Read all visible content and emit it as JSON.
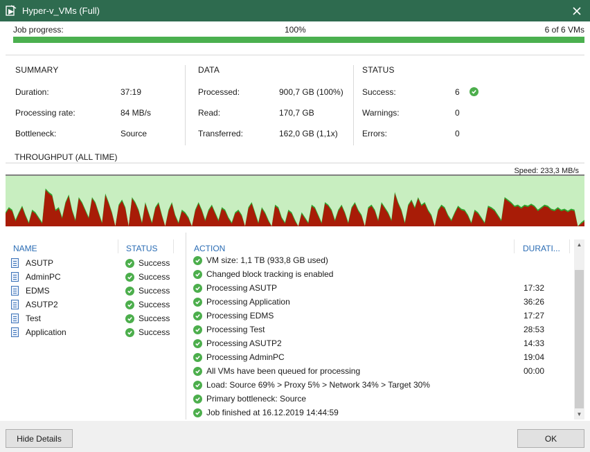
{
  "window": {
    "title": "Hyper-v_VMs (Full)"
  },
  "progress": {
    "label": "Job progress:",
    "percent_text": "100%",
    "vms_text": "6 of 6 VMs",
    "fraction": 1.0
  },
  "summary": {
    "heading": "SUMMARY",
    "rows": [
      {
        "label": "Duration:",
        "value": "37:19"
      },
      {
        "label": "Processing rate:",
        "value": "84 MB/s"
      },
      {
        "label": "Bottleneck:",
        "value": "Source"
      }
    ]
  },
  "data_section": {
    "heading": "DATA",
    "rows": [
      {
        "label": "Processed:",
        "value": "900,7 GB (100%)"
      },
      {
        "label": "Read:",
        "value": "170,7 GB"
      },
      {
        "label": "Transferred:",
        "value": "162,0 GB (1,1x)"
      }
    ]
  },
  "status_section": {
    "heading": "STATUS",
    "rows": [
      {
        "label": "Success:",
        "value": "6"
      },
      {
        "label": "Warnings:",
        "value": "0"
      },
      {
        "label": "Errors:",
        "value": "0"
      }
    ]
  },
  "throughput": {
    "heading": "THROUGHPUT (ALL TIME)",
    "speed_text": "Speed: 233,3 MB/s",
    "colors": {
      "background": "#c8eec0",
      "read": "#2fa52f",
      "transferred": "#a81c07"
    },
    "samples": [
      0.25,
      0.35,
      0.3,
      0.1,
      0.25,
      0.38,
      0.2,
      0.05,
      0.3,
      0.25,
      0.15,
      0.05,
      0.72,
      0.65,
      0.6,
      0.3,
      0.35,
      0.15,
      0.45,
      0.6,
      0.3,
      0.1,
      0.55,
      0.45,
      0.3,
      0.15,
      0.55,
      0.45,
      0.25,
      0.05,
      0.62,
      0.45,
      0.25,
      0.0,
      0.4,
      0.5,
      0.35,
      0.0,
      0.55,
      0.45,
      0.3,
      0.05,
      0.45,
      0.25,
      0.05,
      0.35,
      0.45,
      0.2,
      0.0,
      0.3,
      0.45,
      0.2,
      0.05,
      0.3,
      0.25,
      0.15,
      0.0,
      0.3,
      0.45,
      0.3,
      0.1,
      0.3,
      0.4,
      0.25,
      0.1,
      0.35,
      0.3,
      0.15,
      0.05,
      0.25,
      0.3,
      0.2,
      0.0,
      0.35,
      0.45,
      0.25,
      0.05,
      0.35,
      0.25,
      0.1,
      0.0,
      0.4,
      0.35,
      0.15,
      0.05,
      0.3,
      0.25,
      0.1,
      0.0,
      0.25,
      0.15,
      0.05,
      0.4,
      0.35,
      0.2,
      0.05,
      0.45,
      0.4,
      0.3,
      0.1,
      0.3,
      0.4,
      0.25,
      0.05,
      0.35,
      0.45,
      0.3,
      0.2,
      0.0,
      0.35,
      0.4,
      0.3,
      0.1,
      0.45,
      0.35,
      0.25,
      0.1,
      0.65,
      0.45,
      0.3,
      0.05,
      0.4,
      0.5,
      0.35,
      0.55,
      0.4,
      0.45,
      0.3,
      0.2,
      0.0,
      0.3,
      0.4,
      0.35,
      0.2,
      0.1,
      0.25,
      0.38,
      0.32,
      0.3,
      0.2,
      0.05,
      0.3,
      0.25,
      0.15,
      0.05,
      0.38,
      0.35,
      0.3,
      0.2,
      0.1,
      0.55,
      0.5,
      0.45,
      0.38,
      0.4,
      0.35,
      0.4,
      0.38,
      0.42,
      0.38,
      0.3,
      0.35,
      0.4,
      0.38,
      0.32,
      0.3,
      0.35,
      0.3,
      0.32,
      0.28,
      0.32,
      0.3,
      0.0,
      0.05,
      0.1
    ]
  },
  "vm_list": {
    "name_header": "NAME",
    "status_header": "STATUS",
    "items": [
      {
        "name": "ASUTP",
        "status": "Success"
      },
      {
        "name": "AdminPC",
        "status": "Success"
      },
      {
        "name": "EDMS",
        "status": "Success"
      },
      {
        "name": "ASUTP2",
        "status": "Success"
      },
      {
        "name": "Test",
        "status": "Success"
      },
      {
        "name": "Application",
        "status": "Success"
      }
    ]
  },
  "actions": {
    "action_header": "ACTION",
    "duration_header": "DURATI...",
    "items": [
      {
        "text": "VM size: 1,1 TB (933,8 GB used)",
        "duration": ""
      },
      {
        "text": "Changed block tracking is enabled",
        "duration": ""
      },
      {
        "text": "Processing ASUTP",
        "duration": "17:32"
      },
      {
        "text": "Processing Application",
        "duration": "36:26"
      },
      {
        "text": "Processing EDMS",
        "duration": "17:27"
      },
      {
        "text": "Processing Test",
        "duration": "28:53"
      },
      {
        "text": "Processing ASUTP2",
        "duration": "14:33"
      },
      {
        "text": "Processing AdminPC",
        "duration": "19:04"
      },
      {
        "text": "All VMs have been queued for processing",
        "duration": "00:00"
      },
      {
        "text": "Load: Source 69% > Proxy 5% > Network 34% > Target 30%",
        "duration": ""
      },
      {
        "text": "Primary bottleneck: Source",
        "duration": ""
      },
      {
        "text": "Job finished at 16.12.2019 14:44:59",
        "duration": ""
      }
    ]
  },
  "buttons": {
    "hide_details": "Hide Details",
    "ok": "OK"
  },
  "icons": {
    "app": "veeam-job-icon",
    "close": "close-icon",
    "success": "success-check-icon",
    "vm": "vm-icon"
  }
}
